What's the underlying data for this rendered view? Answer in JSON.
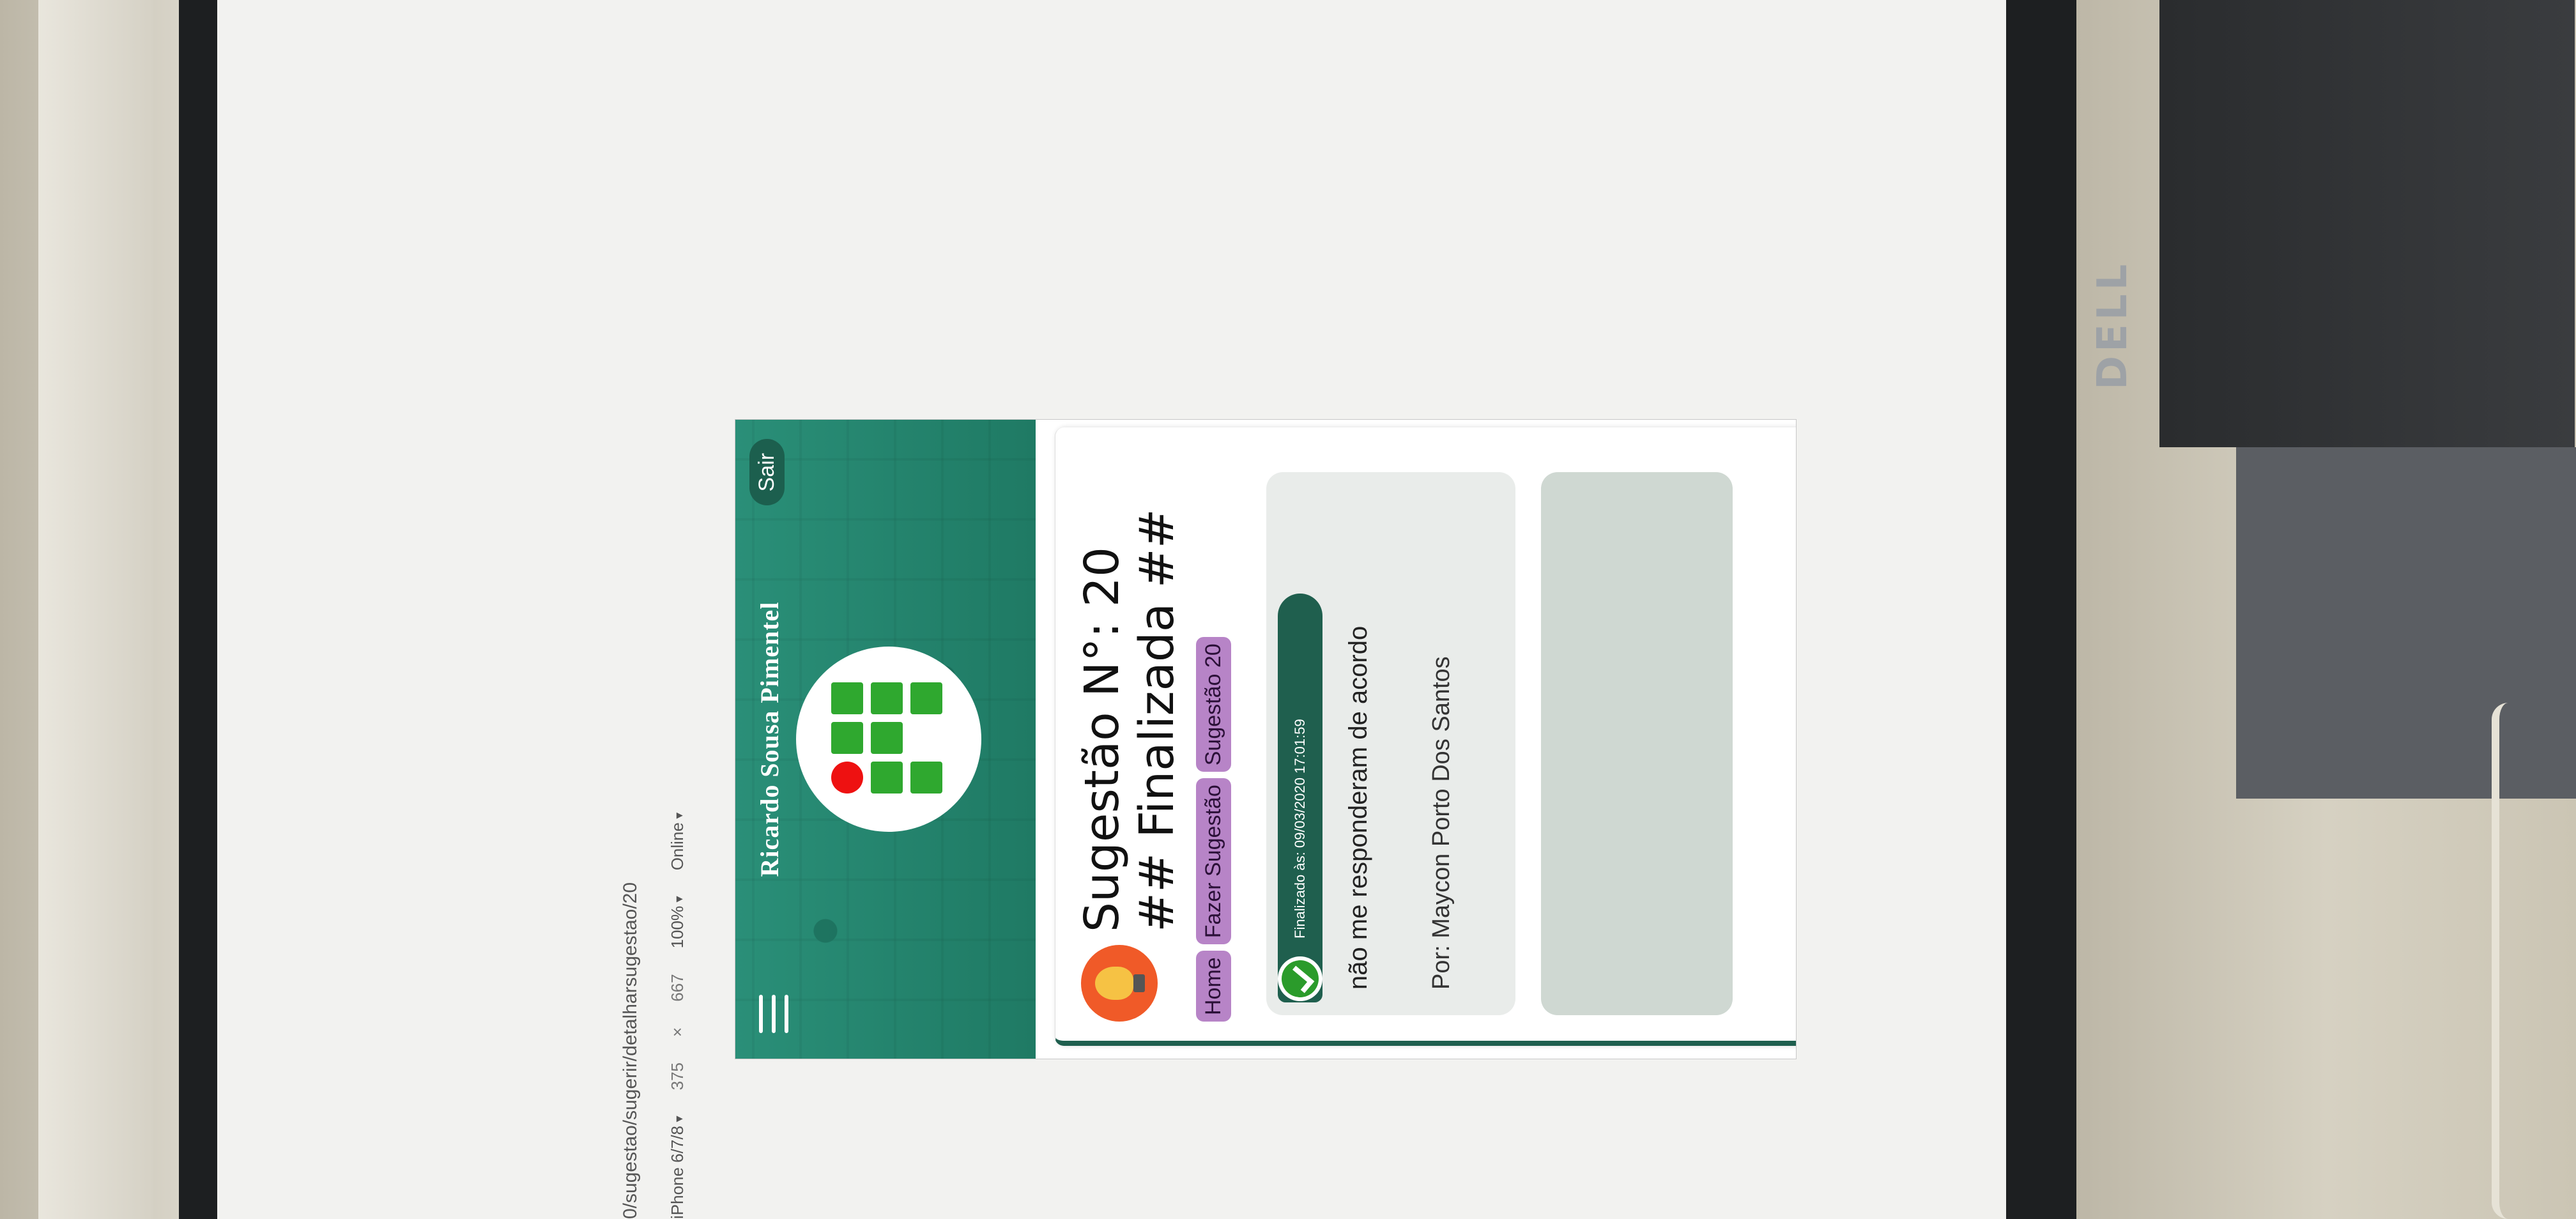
{
  "browser": {
    "url": "0/sugestao/sugerir/detalharsugestao/20",
    "device": "iPhone 6/7/8",
    "width": "375",
    "times": "×",
    "height": "667",
    "zoom": "100%",
    "network": "Online"
  },
  "header": {
    "menu_icon": "hamburger-icon",
    "user_name": "Ricardo Sousa Pimentel",
    "logout_label": "Sair",
    "logo": "ifpe-logo"
  },
  "suggestion": {
    "icon": "lightbulb-icon",
    "title_line1": "Sugestão N°: 20",
    "title_line2": "## Finalizada ##",
    "breadcrumbs": [
      {
        "label": "Home"
      },
      {
        "label": "Fazer Sugestão"
      },
      {
        "label": "Sugestão 20"
      }
    ]
  },
  "reply": {
    "status": "Finalizado às: 09/03/2020 17:01:59",
    "text": "não me responderam de acordo",
    "author": "Por: Maycon Porto Dos Santos"
  },
  "taskbar": {
    "icons": [
      "show-desktop-icon",
      "file-explorer-icon",
      "edge-icon",
      "chrome-icon",
      "snip-icon",
      "calculator-icon",
      "stack-icon",
      "sticky-notes-icon",
      "pe-app-icon"
    ]
  },
  "hardware": {
    "brand": "DELL"
  },
  "colors": {
    "primary": "#1f5f4e",
    "banner": "#2a8f78",
    "breadcrumb": "#b784c7",
    "accent_bulb": "#f05a28",
    "check": "#2b9b2b"
  }
}
